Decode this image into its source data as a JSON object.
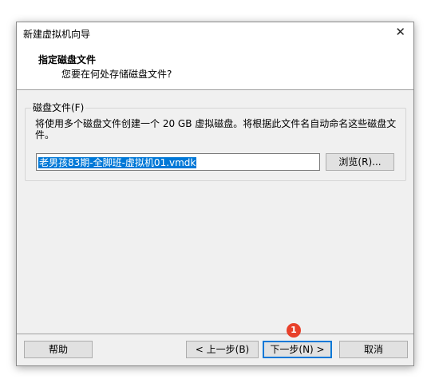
{
  "window": {
    "title": "新建虚拟机向导",
    "close_glyph": "✕"
  },
  "header": {
    "title": "指定磁盘文件",
    "subtitle": "您要在何处存储磁盘文件?"
  },
  "disk_file": {
    "group_label": "磁盘文件(F)",
    "description": "将使用多个磁盘文件创建一个 20 GB 虚拟磁盘。将根据此文件名自动命名这些磁盘文件。",
    "filename_value": "老男孩83期-全脚班-虚拟机01.vmdk",
    "browse_label": "浏览(R)..."
  },
  "footer": {
    "help_label": "帮助",
    "back_label": "< 上一步(B)",
    "next_label": "下一步(N) >",
    "cancel_label": "取消"
  },
  "annotation": {
    "step_number": "1",
    "color": "#e8402a"
  },
  "colors": {
    "selection": "#0078d7",
    "dialog_bg": "#f0f0f0"
  }
}
